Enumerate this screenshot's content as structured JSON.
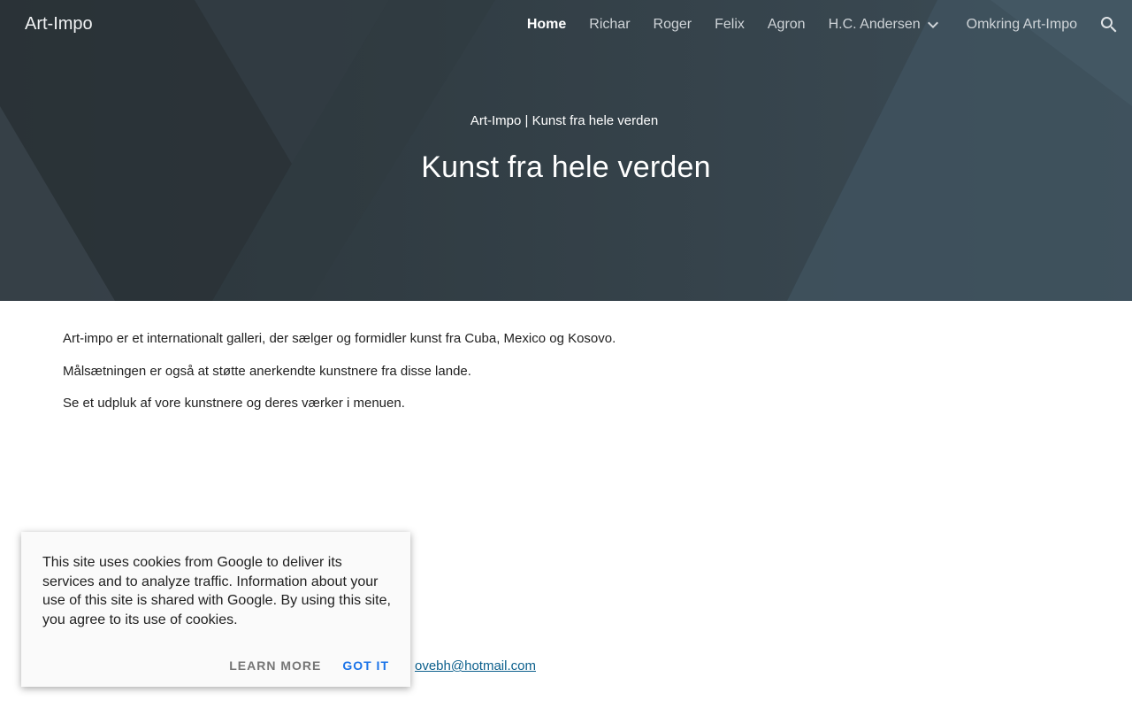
{
  "header": {
    "site_title": "Art-Impo",
    "nav": [
      {
        "label": "Home",
        "active": true
      },
      {
        "label": "Richar"
      },
      {
        "label": "Roger"
      },
      {
        "label": "Felix"
      },
      {
        "label": "Agron"
      },
      {
        "label": "H.C. Andersen",
        "dropdown": true
      },
      {
        "label": "Omkring Art-Impo"
      }
    ],
    "search_icon": "search-icon"
  },
  "hero": {
    "subtitle": "Art-Impo | Kunst fra hele verden",
    "title": "Kunst fra hele verden"
  },
  "main": {
    "paragraphs": [
      "Art-impo er et internationalt galleri, der sælger og formidler kunst fra Cuba, Mexico og Kosovo.",
      "Målsætningen er også at støtte anerkendte kunstnere fra disse lande.",
      "Se et udpluk af vore kunstnere og deres værker i menuen."
    ],
    "email": "ovebh@hotmail.com"
  },
  "cookie_banner": {
    "text": "This site uses cookies from Google to deliver its services and to analyze traffic. Information about your use of this site is shared with Google. By using this site, you agree to its use of cookies.",
    "learn_more": "LEARN MORE",
    "got_it": "GOT IT"
  },
  "colors": {
    "hero_bg": "#34414a",
    "link": "#0b5f8c",
    "accent": "#1a73e8"
  }
}
